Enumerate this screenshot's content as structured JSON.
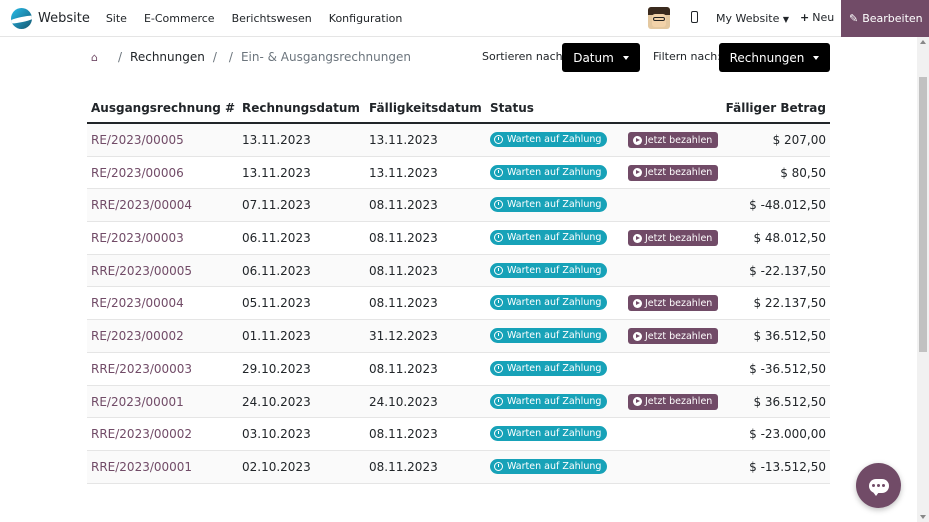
{
  "topbar": {
    "brand": "Website",
    "menu": [
      "Site",
      "E-Commerce",
      "Berichtswesen",
      "Konfiguration"
    ],
    "site_select": "My Website",
    "new_label": "Neu",
    "edit_label": "Bearbeiten"
  },
  "breadcrumb": {
    "home_icon": "home-icon",
    "items": [
      "Rechnungen",
      "Ein- & Ausgangsrechnungen"
    ]
  },
  "controls": {
    "sort_label": "Sortieren nach:",
    "sort_value": "Datum",
    "filter_label": "Filtern nach:",
    "filter_value": "Rechnungen"
  },
  "table": {
    "headers": [
      "Ausgangsrechnung #",
      "Rechnungsdatum",
      "Fälligkeitsdatum",
      "Status",
      "Fälliger Betrag"
    ],
    "status_label": "Warten auf Zahlung",
    "pay_label": "Jetzt bezahlen",
    "rows": [
      {
        "number": "RE/2023/00005",
        "date": "13.11.2023",
        "due": "13.11.2023",
        "pay": true,
        "amount": "$ 207,00"
      },
      {
        "number": "RE/2023/00006",
        "date": "13.11.2023",
        "due": "13.11.2023",
        "pay": true,
        "amount": "$ 80,50"
      },
      {
        "number": "RRE/2023/00004",
        "date": "07.11.2023",
        "due": "08.11.2023",
        "pay": false,
        "amount": "$ -48.012,50"
      },
      {
        "number": "RE/2023/00003",
        "date": "06.11.2023",
        "due": "08.11.2023",
        "pay": true,
        "amount": "$ 48.012,50"
      },
      {
        "number": "RRE/2023/00005",
        "date": "06.11.2023",
        "due": "08.11.2023",
        "pay": false,
        "amount": "$ -22.137,50"
      },
      {
        "number": "RE/2023/00004",
        "date": "05.11.2023",
        "due": "08.11.2023",
        "pay": true,
        "amount": "$ 22.137,50"
      },
      {
        "number": "RE/2023/00002",
        "date": "01.11.2023",
        "due": "31.12.2023",
        "pay": true,
        "amount": "$ 36.512,50"
      },
      {
        "number": "RRE/2023/00003",
        "date": "29.10.2023",
        "due": "08.11.2023",
        "pay": false,
        "amount": "$ -36.512,50"
      },
      {
        "number": "RE/2023/00001",
        "date": "24.10.2023",
        "due": "24.10.2023",
        "pay": true,
        "amount": "$ 36.512,50"
      },
      {
        "number": "RRE/2023/00002",
        "date": "03.10.2023",
        "due": "08.11.2023",
        "pay": false,
        "amount": "$ -23.000,00"
      },
      {
        "number": "RRE/2023/00001",
        "date": "02.10.2023",
        "due": "08.11.2023",
        "pay": false,
        "amount": "$ -13.512,50"
      }
    ]
  },
  "colors": {
    "brand": "#714b67",
    "status": "#17a2b8"
  }
}
